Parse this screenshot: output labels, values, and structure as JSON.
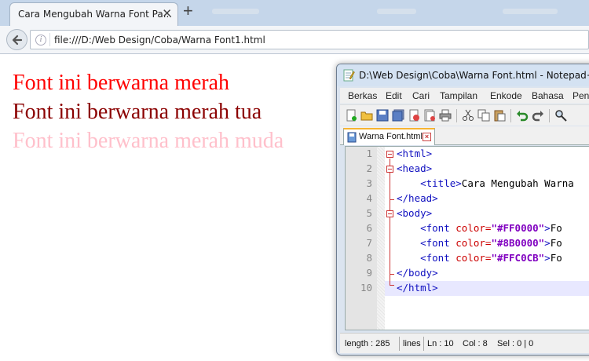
{
  "browser": {
    "tab_title": "Cara Mengubah Warna Font Pa...",
    "tab_close": "✕",
    "new_tab": "+",
    "url": "file:///D:/Web Design/Coba/Warna Font1.html",
    "info_glyph": "i"
  },
  "page": {
    "lines": [
      {
        "text": "Font ini berwarna merah",
        "color": "#FF0000"
      },
      {
        "text": "Font ini berwarna merah tua",
        "color": "#8B0000"
      },
      {
        "text": "Font ini berwarna merah muda",
        "color": "#FFC0CB"
      }
    ]
  },
  "notepad": {
    "title": "D:\\Web Design\\Coba\\Warna Font.html - Notepad++",
    "menu": [
      "Berkas",
      "Edit",
      "Cari",
      "Tampilan",
      "Enkode",
      "Bahasa",
      "Peng"
    ],
    "doc_tab": "Warna Font.html",
    "line_numbers": [
      "1",
      "2",
      "3",
      "4",
      "5",
      "6",
      "7",
      "8",
      "9",
      "10"
    ],
    "code": {
      "l1": "<html>",
      "l2": "<head>",
      "l3_tag": "<title>",
      "l3_text": "Cara Mengubah Warna",
      "l4": "</head>",
      "l5": "<body>",
      "font_open": "<font",
      "color_attr": "color=",
      "l6_val": "\"#FF0000\"",
      "l7_val": "\"#8B0000\"",
      "l8_val": "\"#FFC0CB\"",
      "close_bracket": ">",
      "trailing": "Fo",
      "l9": "</body>",
      "l10": "</html>"
    },
    "status": {
      "length": "length : 285",
      "lines": "lines",
      "ln": "Ln : 10",
      "col": "Col : 8",
      "sel": "Sel : 0 | 0"
    }
  },
  "colors": {
    "red": "#FF0000",
    "dark_red": "#8B0000",
    "pink": "#FFC0CB",
    "tag_blue": "#1010c0",
    "attr_red": "#cc0000",
    "value_purple": "#8000c0"
  }
}
